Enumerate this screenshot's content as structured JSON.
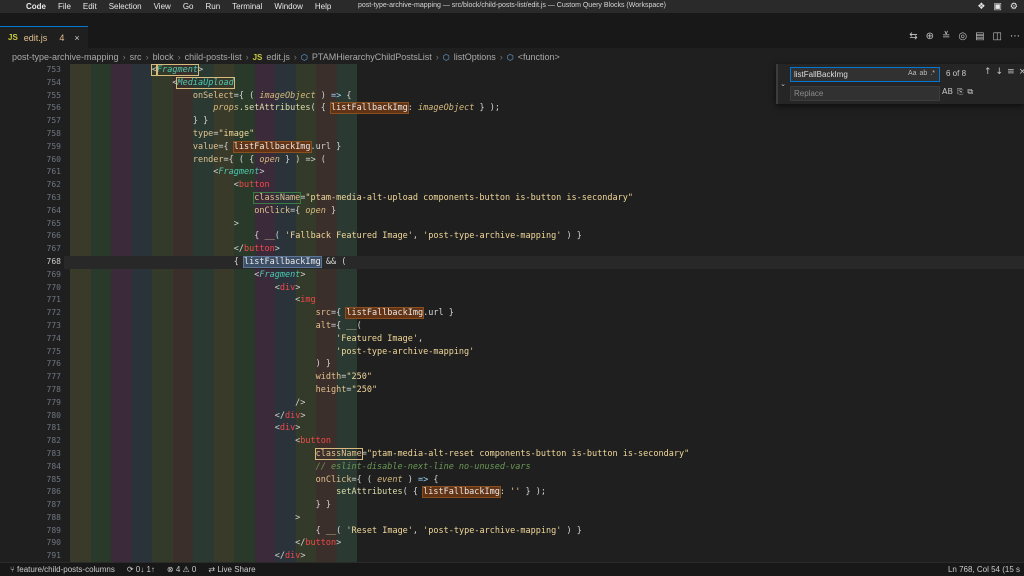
{
  "menubar": {
    "apple": "",
    "items": [
      "Code",
      "File",
      "Edit",
      "Selection",
      "View",
      "Go",
      "Run",
      "Terminal",
      "Window",
      "Help"
    ],
    "window_title": "post-type-archive-mapping — src/block/child-posts-list/edit.js — Custom Query Blocks (Workspace)"
  },
  "tab": {
    "icon": "JS",
    "label": "edit.js",
    "count": "4",
    "close": "×"
  },
  "breadcrumbs": [
    "post-type-archive-mapping",
    "src",
    "block",
    "child-posts-list",
    "edit.js",
    "PTAMHierarchyChildPostsList",
    "listOptions",
    "<function>"
  ],
  "find": {
    "search_value": "listFallBackImg",
    "replace_placeholder": "Replace",
    "match_count": "6 of 8",
    "opt_case": "Aa",
    "opt_word": "ab",
    "opt_regex": ".*",
    "opt_preserve": "AB"
  },
  "editor": {
    "current_line": "768",
    "line_numbers": [
      "753",
      "754",
      "755",
      "756",
      "757",
      "758",
      "759",
      "760",
      "761",
      "762",
      "763",
      "764",
      "765",
      "766",
      "767",
      "768",
      "769",
      "770",
      "771",
      "772",
      "773",
      "774",
      "775",
      "776",
      "777",
      "778",
      "779",
      "780",
      "781",
      "782",
      "783",
      "784",
      "785",
      "786",
      "787",
      "788",
      "789",
      "790",
      "791"
    ]
  },
  "status": {
    "branch": "feature/child-posts-columns",
    "sync": "0↓ 1↑",
    "problems": "⊗ 4 ⚠ 0",
    "live_share": "Live Share",
    "position": "Ln 768, Col 54 (15 s"
  },
  "colors": {
    "accent": "#0078d4",
    "find_highlight": "#623315",
    "indent_stripes": [
      "#3a3a2a",
      "#2a3a2a",
      "#3a2a3a",
      "#2a333a",
      "#333a2a",
      "#3a2f2a",
      "#2a3a33"
    ]
  }
}
